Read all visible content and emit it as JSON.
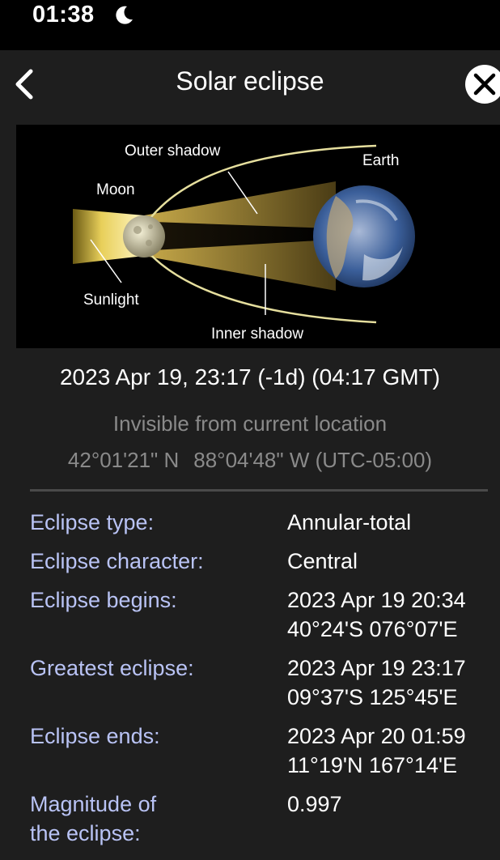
{
  "status_bar": {
    "time": "01:38"
  },
  "nav": {
    "title": "Solar eclipse"
  },
  "diagram": {
    "labels": {
      "outer_shadow": "Outer shadow",
      "earth": "Earth",
      "moon": "Moon",
      "sunlight": "Sunlight",
      "inner_shadow": "Inner shadow"
    }
  },
  "event": {
    "datetime": "2023 Apr 19, 23:17 (-1d) (04:17 GMT)",
    "visibility": "Invisible from current location",
    "latitude": "42°01'21\" N",
    "longitude": "88°04'48\" W (UTC-05:00)"
  },
  "details": [
    {
      "label": "Eclipse type:",
      "value": "Annular-total"
    },
    {
      "label": "Eclipse character:",
      "value": "Central"
    },
    {
      "label": "Eclipse begins:",
      "value": "2023 Apr 19 20:34",
      "sub": "40°24'S 076°07'E"
    },
    {
      "label": "Greatest eclipse:",
      "value": "2023 Apr 19 23:17",
      "sub": "09°37'S 125°45'E"
    },
    {
      "label": "Eclipse ends:",
      "value": "2023 Apr 20 01:59",
      "sub": "11°19'N 167°14'E"
    },
    {
      "label": "Magnitude of",
      "label2": "the eclipse:",
      "value": "0.997"
    }
  ],
  "colors": {
    "background": "#1e1e1e",
    "label": "#b9c3f5",
    "secondary": "#8a8a8a"
  }
}
